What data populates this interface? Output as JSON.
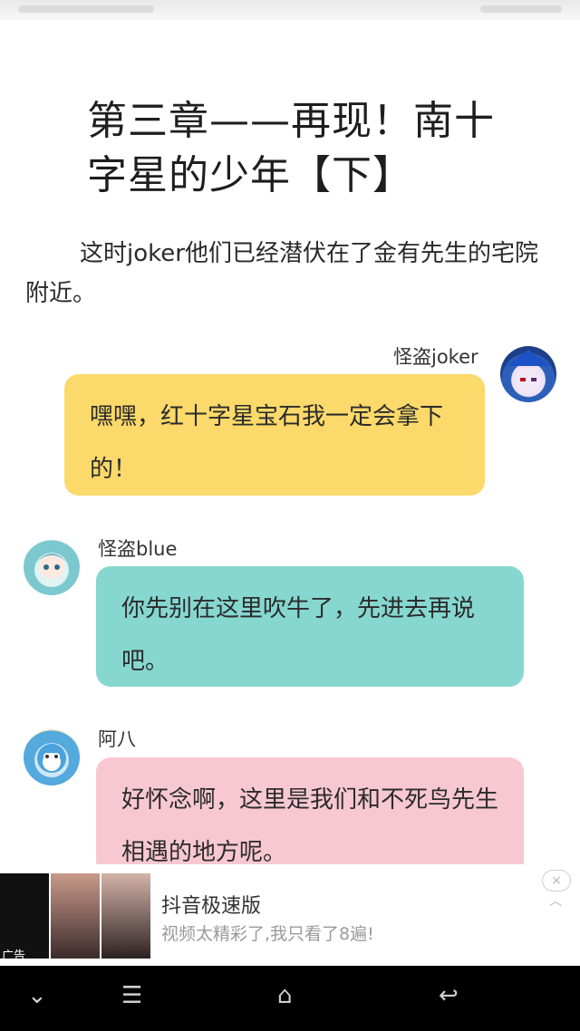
{
  "chapter": {
    "title": "第三章——再现！南十字星的少年【下】",
    "narration": "这时joker他们已经潜伏在了金有先生的宅院附近。"
  },
  "messages": [
    {
      "speaker": "怪盗joker",
      "text": "嘿嘿，红十字星宝石我一定会拿下的！",
      "color": "#fbd96a",
      "side": "right"
    },
    {
      "speaker": "怪盗blue",
      "text": "你先别在这里吹牛了，先进去再说吧。",
      "color": "#86d7cf",
      "side": "left"
    },
    {
      "speaker": "阿八",
      "text": "好怀念啊，这里是我们和不死鸟先生相遇的地方呢。",
      "color": "#f8c8d2",
      "side": "left"
    }
  ],
  "ad": {
    "tag": "广告",
    "title": "抖音极速版",
    "subtitle": "视频太精彩了,我只看了8遍!",
    "close_icon": "×"
  },
  "navbar": {
    "down": "⌄",
    "menu": "☰",
    "home": "⌂",
    "back": "↩"
  }
}
